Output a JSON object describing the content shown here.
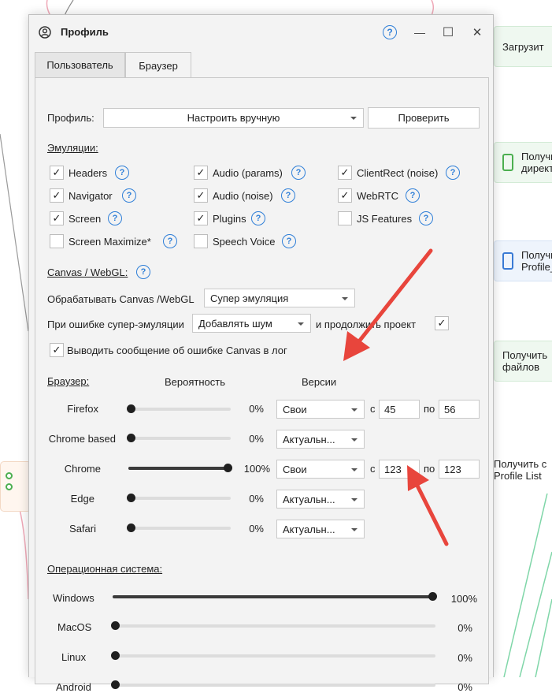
{
  "background": {
    "nodes": [
      {
        "text": "Загрузит"
      },
      {
        "text": "Получи\nдирект"
      },
      {
        "text": "Получи\nProfile_"
      },
      {
        "text": "Получить\nфайлов"
      },
      {
        "text": "Получить с\nProfile List"
      }
    ]
  },
  "window": {
    "title": "Профиль",
    "help": "?",
    "minimize": "—",
    "maximize": "☐",
    "close": "✕"
  },
  "tabs": [
    {
      "label": "Пользователь",
      "active": false
    },
    {
      "label": "Браузер",
      "active": true
    }
  ],
  "profile": {
    "label": "Профиль:",
    "value": "Настроить вручную",
    "check_button": "Проверить"
  },
  "emulations": {
    "heading": "Эмуляции:",
    "items": [
      {
        "label": "Headers",
        "checked": true
      },
      {
        "label": "Audio (params)",
        "checked": true
      },
      {
        "label": "ClientRect (noise)",
        "checked": true
      },
      {
        "label": "Navigator",
        "checked": true
      },
      {
        "label": "Audio (noise)",
        "checked": true
      },
      {
        "label": "WebRTC",
        "checked": true
      },
      {
        "label": "Screen",
        "checked": true
      },
      {
        "label": "Plugins",
        "checked": true
      },
      {
        "label": "JS Features",
        "checked": false
      },
      {
        "label": "Screen Maximize*",
        "checked": false
      },
      {
        "label": "Speech Voice",
        "checked": false
      }
    ]
  },
  "canvas": {
    "heading": "Canvas / WebGL:",
    "process_label": "Обрабатывать Canvas /WebGL",
    "process_value": "Супер эмуляция",
    "error_label": "При ошибке супер-эмуляции",
    "error_value": "Добавлять шум",
    "continue_label": "и продолжить проект",
    "continue_checked": true,
    "log_label": "Выводить сообщение об ошибке Canvas в лог",
    "log_checked": true
  },
  "browser": {
    "heading": "Браузер:",
    "col_probability": "Вероятность",
    "col_versions": "Версии",
    "from_label": "с",
    "to_label": "по",
    "rows": [
      {
        "name": "Firefox",
        "probability": 0,
        "pct": "0%",
        "mode": "Свои",
        "from": "45",
        "to": "56",
        "has_range": true
      },
      {
        "name": "Chrome based",
        "probability": 0,
        "pct": "0%",
        "mode": "Актуальн...",
        "has_range": false
      },
      {
        "name": "Chrome",
        "probability": 100,
        "pct": "100%",
        "mode": "Свои",
        "from": "123",
        "to": "123",
        "has_range": true
      },
      {
        "name": "Edge",
        "probability": 0,
        "pct": "0%",
        "mode": "Актуальн...",
        "has_range": false
      },
      {
        "name": "Safari",
        "probability": 0,
        "pct": "0%",
        "mode": "Актуальн...",
        "has_range": false
      }
    ]
  },
  "os": {
    "heading": "Операционная система:",
    "rows": [
      {
        "name": "Windows",
        "probability": 100,
        "pct": "100%"
      },
      {
        "name": "MacOS",
        "probability": 0,
        "pct": "0%"
      },
      {
        "name": "Linux",
        "probability": 0,
        "pct": "0%"
      },
      {
        "name": "Android",
        "probability": 0,
        "pct": "0%"
      }
    ]
  },
  "colors": {
    "accent": "#2f7fd8",
    "arrow": "#e8453c",
    "slider": "#1f1f1f"
  }
}
